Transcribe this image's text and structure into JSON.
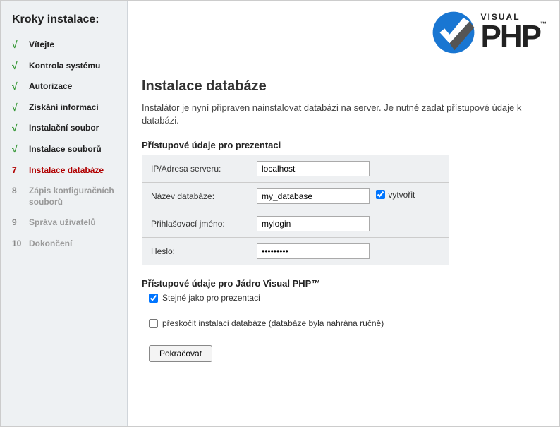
{
  "sidebar": {
    "title": "Kroky instalace:",
    "steps": [
      {
        "marker": "√",
        "label": "Vítejte",
        "state": "done"
      },
      {
        "marker": "√",
        "label": "Kontrola systému",
        "state": "done"
      },
      {
        "marker": "√",
        "label": "Autorizace",
        "state": "done"
      },
      {
        "marker": "√",
        "label": "Získání informací",
        "state": "done"
      },
      {
        "marker": "√",
        "label": "Instalační soubor",
        "state": "done"
      },
      {
        "marker": "√",
        "label": "Instalace souborů",
        "state": "done"
      },
      {
        "marker": "7",
        "label": "Instalace databáze",
        "state": "current"
      },
      {
        "marker": "8",
        "label": "Zápis konfiguračních souborů",
        "state": "pending"
      },
      {
        "marker": "9",
        "label": "Správa uživatelů",
        "state": "pending"
      },
      {
        "marker": "10",
        "label": "Dokončení",
        "state": "pending"
      }
    ]
  },
  "logo": {
    "visual": "VISUAL",
    "php": "PHP",
    "tm": "™"
  },
  "main": {
    "heading": "Instalace databáze",
    "intro": "Instalátor je nyní připraven nainstalovat databázi na server. Je nutné zadat přístupové údaje k databázi.",
    "section1_title": "Přístupové údaje pro prezentaci",
    "fields": {
      "server_label": "IP/Adresa serveru:",
      "server_value": "localhost",
      "dbname_label": "Název databáze:",
      "dbname_value": "my_database",
      "create_label": "vytvořit",
      "create_checked": true,
      "login_label": "Přihlašovací jméno:",
      "login_value": "mylogin",
      "password_label": "Heslo:",
      "password_value": "•••••••••"
    },
    "section2_title": "Přístupové údaje pro Jádro Visual PHP™",
    "same_label": "Stejné jako pro prezentaci",
    "same_checked": true,
    "skip_label": "přeskočit instalaci databáze (databáze byla nahrána ručně)",
    "skip_checked": false,
    "submit": "Pokračovat"
  }
}
